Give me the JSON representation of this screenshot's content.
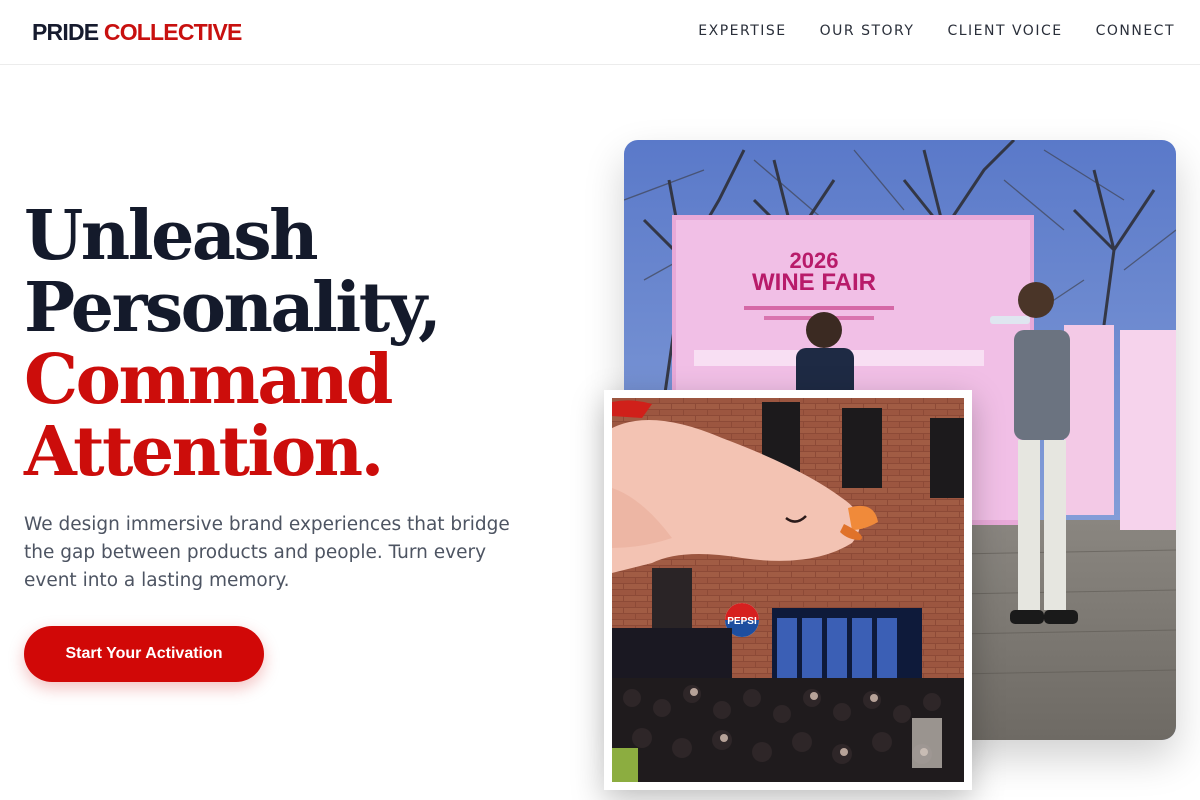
{
  "brand": {
    "part1": "PRIDE",
    "part2": "COLLECTIVE"
  },
  "nav": [
    {
      "label": "EXPERTISE"
    },
    {
      "label": "OUR STORY"
    },
    {
      "label": "CLIENT VOICE"
    },
    {
      "label": "CONNECT"
    }
  ],
  "hero": {
    "headline_line1": "Unleash",
    "headline_line2": "Personality,",
    "headline_line3": "Command",
    "headline_line4": "Attention.",
    "subtext": "We design immersive brand experiences that bridge the gap between products and people. Turn every event into a lasting memory.",
    "cta_label": "Start Your Activation"
  },
  "images": {
    "main": {
      "banner_year": "2026",
      "banner_title": "WINE FAIR"
    },
    "inset": {
      "brand_sign": "PEPSI"
    }
  },
  "colors": {
    "accent": "#d10807",
    "heading_dark": "#141a2b",
    "body_text": "#4d5462"
  }
}
